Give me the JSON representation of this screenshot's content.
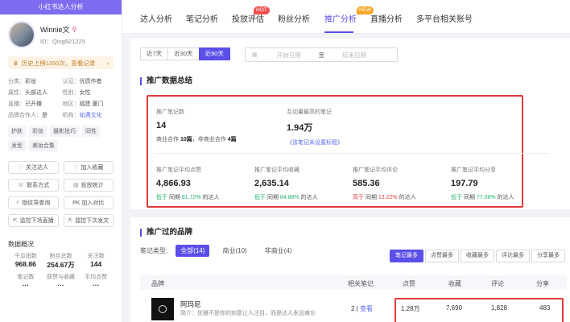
{
  "sidebar": {
    "header": "小红书达人分析",
    "profile": {
      "name": "Winnie文",
      "id": "ID：Qing921225"
    },
    "history": "历史上榜1350次，查看记录",
    "attrs": [
      {
        "k": "分类：",
        "v": "彩妆"
      },
      {
        "k": "认证：",
        "v": "优质作者"
      },
      {
        "k": "属性：",
        "v": "头部达人"
      },
      {
        "k": "性别：",
        "v": "女性"
      },
      {
        "k": "直播：",
        "v": "已开播"
      },
      {
        "k": "地区：",
        "v": "福建 厦门"
      },
      {
        "k": "品牌合作人：",
        "v": "是"
      },
      {
        "k": "机构：",
        "v": "如遇文化"
      }
    ],
    "tags": [
      "护肤",
      "彩妆",
      "摄影技巧",
      "同性",
      "发型",
      "美妆合集"
    ],
    "buttons": [
      {
        "icon": "heart-icon",
        "label": "关注达人"
      },
      {
        "icon": "heart-icon",
        "label": "加入收藏"
      },
      {
        "icon": "phone-icon",
        "label": "联系方式"
      },
      {
        "icon": "report-icon",
        "label": "投放统计"
      },
      {
        "icon": "search-icon",
        "label": "指纹导查询"
      },
      {
        "icon": "pk-icon",
        "label": "PK 加入对比"
      },
      {
        "icon": "export-icon",
        "label": "监控下场直播"
      },
      {
        "icon": "export-icon",
        "label": "监控下次发文"
      }
    ],
    "overview_title": "数据概况",
    "overview": [
      {
        "l": "千瓜指数",
        "n": "968.86"
      },
      {
        "l": "粉丝总数",
        "n": "254.67万"
      },
      {
        "l": "关注数",
        "n": "144"
      },
      {
        "l": "笔记数",
        "n": "···"
      },
      {
        "l": "获赞与收藏",
        "n": "···"
      },
      {
        "l": "平均点赞",
        "n": "···"
      }
    ]
  },
  "tabs": [
    {
      "label": "达人分析",
      "active": false
    },
    {
      "label": "笔记分析",
      "active": false
    },
    {
      "label": "投放评估",
      "active": false,
      "badge": "HOT"
    },
    {
      "label": "粉丝分析",
      "active": false
    },
    {
      "label": "推广分析",
      "active": true
    },
    {
      "label": "直播分析",
      "active": false,
      "badge": "NEW"
    },
    {
      "label": "多平台相关账号",
      "active": false
    }
  ],
  "range": {
    "options": [
      "近7天",
      "近30天",
      "近90天"
    ],
    "active_index": 2,
    "start_placeholder": "开始日期",
    "separator": "至",
    "end_placeholder": "结束日期"
  },
  "summary": {
    "title": "推广数据总结",
    "count_label": "推广笔记数",
    "count": "14",
    "count_sub_a": "商业合作",
    "count_sub_a_val": "10篇",
    "count_sub_b": "，非商业合作",
    "count_sub_b_val": "4篇",
    "top_label": "互动量最高的笔记",
    "top_value": "1.94万",
    "top_link": "《该笔记未设置标题》",
    "metrics": [
      {
        "label": "推广笔记平均点赞",
        "value": "4,866.93",
        "dir": "低于",
        "pre": "同期",
        "pct": "81.72%",
        "post": "的达人",
        "trend": "down"
      },
      {
        "label": "推广笔记平均收藏",
        "value": "2,635.14",
        "dir": "低于",
        "pre": "同期",
        "pct": "84.88%",
        "post": "的达人",
        "trend": "down"
      },
      {
        "label": "推广笔记平均评论",
        "value": "585.36",
        "dir": "高于",
        "pre": "同期",
        "pct": "13.22%",
        "post": "的达人",
        "trend": "up"
      },
      {
        "label": "推广笔记平均分享",
        "value": "197.79",
        "dir": "低于",
        "pre": "同期",
        "pct": "77.08%",
        "post": "的达人",
        "trend": "down"
      }
    ]
  },
  "brands": {
    "title": "推广过的品牌",
    "filter_label": "笔记类型:",
    "filters": [
      "全部(14)",
      "商业(10)",
      "非商业(4)"
    ],
    "sorts": [
      "笔记最多",
      "点赞最多",
      "收藏最多",
      "评论最多",
      "分享最多"
    ],
    "headers": [
      "品牌",
      "相关笔记",
      "点赞",
      "收藏",
      "评论",
      "分享"
    ],
    "rows": [
      {
        "name": "阿玛尼",
        "desc": "简介：优雅不是你的刻意让人注目，而是达人永远难忘",
        "notes": "2",
        "view": "查看",
        "likes": "1.28万",
        "collects": "7,690",
        "comments": "1,828",
        "shares": "483"
      }
    ]
  }
}
